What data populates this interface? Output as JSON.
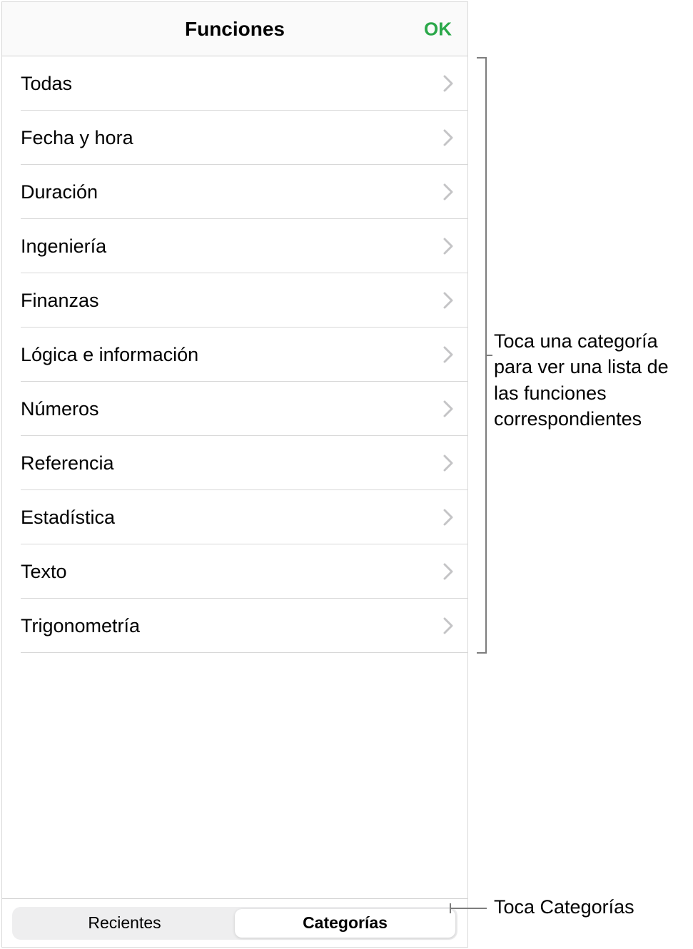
{
  "header": {
    "title": "Funciones",
    "okLabel": "OK"
  },
  "categories": [
    {
      "label": "Todas"
    },
    {
      "label": "Fecha y hora"
    },
    {
      "label": "Duración"
    },
    {
      "label": "Ingeniería"
    },
    {
      "label": "Finanzas"
    },
    {
      "label": "Lógica e información"
    },
    {
      "label": "Números"
    },
    {
      "label": "Referencia"
    },
    {
      "label": "Estadística"
    },
    {
      "label": "Texto"
    },
    {
      "label": "Trigonometría"
    }
  ],
  "tabbar": {
    "recent": "Recientes",
    "categories": "Categorías"
  },
  "callouts": {
    "categoryHint": "Toca una categoría para ver una lista de las funciones correspondientes",
    "tabHint": "Toca Categorías"
  }
}
